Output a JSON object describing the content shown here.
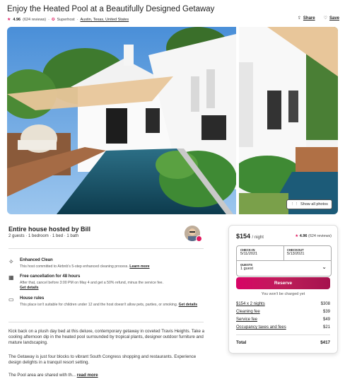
{
  "listing": {
    "title": "Enjoy the Heated Pool at a Beautifully Designed Getaway",
    "rating": "4.96",
    "reviews": "(624 reviews)",
    "superhost": "Superhost",
    "location": "Austin, Texas, United States",
    "share_label": "Share",
    "save_label": "Save",
    "show_all_photos": "Show all photos"
  },
  "host": {
    "title": "Entire house hosted by Bill",
    "subtitle": "2 guests · 1 bedroom · 1 bed · 1 bath"
  },
  "features": [
    {
      "title": "Enhanced Clean",
      "desc": "This host committed to Airbnb's 5-step enhanced cleaning process.",
      "link": "Learn more"
    },
    {
      "title": "Free cancellation for 48 hours",
      "desc": "After that, cancel before 3:00 PM on May 4 and get a 50% refund, minus the service fee.",
      "link": "Get details"
    },
    {
      "title": "House rules",
      "desc": "This place isn't suitable for children under 12 and the host doesn't allow pets, parties, or smoking.",
      "link": "Get details"
    }
  ],
  "description": {
    "p1": "Kick back on a plush day bed at this deluxe, contemporary getaway in coveted Travis Heights. Take a cooling afternoon dip in the heated pool surrounded by tropical plants, designer outdoor furniture and mature landscaping.",
    "p2": "The Getaway is just four blocks to vibrant South Congress shopping and restaurants. Experience design delights in a tranquil resort setting.",
    "p3": "The Pool area are shared with th...",
    "read_more": "read more"
  },
  "booking": {
    "price": "$154",
    "per_night": "/ night",
    "rating": "4.96",
    "reviews": "(624 reviews)",
    "checkin_label": "CHECK-IN",
    "checkin_value": "5/11/2021",
    "checkout_label": "CHECKOUT",
    "checkout_value": "5/13/2021",
    "guests_label": "GUESTS",
    "guests_value": "1 guest",
    "reserve_label": "Reserve",
    "no_charge": "You won't be charged yet",
    "fees": [
      {
        "label": "$154 x 2 nights",
        "value": "$308"
      },
      {
        "label": "Cleaning fee",
        "value": "$39"
      },
      {
        "label": "Service fee",
        "value": "$49"
      },
      {
        "label": "Occupancy taxes and fees",
        "value": "$21"
      }
    ],
    "total_label": "Total",
    "total_value": "$417"
  },
  "colors": {
    "brand": "#e0185e",
    "reserve": "#d70466"
  }
}
